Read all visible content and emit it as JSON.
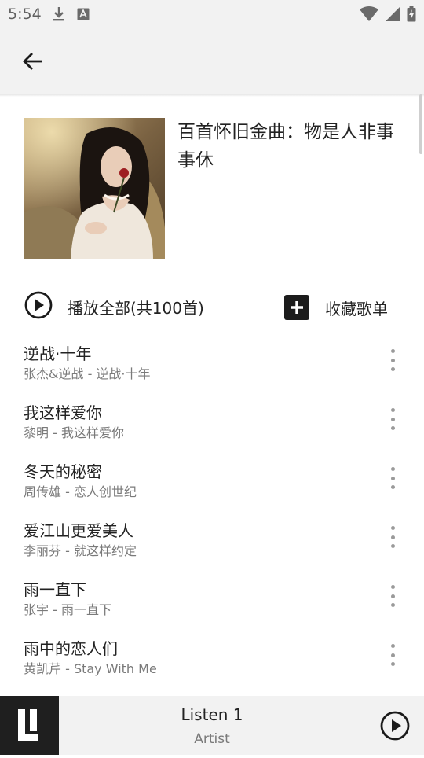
{
  "status_bar": {
    "time": "5:54",
    "icons_left": [
      "download-icon",
      "font-app-icon"
    ],
    "icons_right": [
      "wifi-icon",
      "cell-signal-icon",
      "battery-charging-icon"
    ]
  },
  "app_bar": {
    "back_icon": "arrow-left-icon"
  },
  "playlist": {
    "title": "百首怀旧金曲：物是人非事事休",
    "play_all_label": "播放全部(共100首)",
    "collect_label": "收藏歌单"
  },
  "songs": [
    {
      "title": "逆战·十年",
      "subtitle": "张杰&逆战 - 逆战·十年"
    },
    {
      "title": "我这样爱你",
      "subtitle": "黎明 - 我这样爱你"
    },
    {
      "title": "冬天的秘密",
      "subtitle": "周传雄 - 恋人创世纪"
    },
    {
      "title": "爱江山更爱美人",
      "subtitle": "李丽芬 - 就这样约定"
    },
    {
      "title": "雨一直下",
      "subtitle": "张宇 - 雨一直下"
    },
    {
      "title": "雨中的恋人们",
      "subtitle": "黄凯芹 - Stay With Me"
    }
  ],
  "player": {
    "title": "Listen 1",
    "artist": "Artist"
  },
  "colors": {
    "bar_background": "#f2f2f2",
    "text_primary": "#222222",
    "text_secondary": "#7a7a7a",
    "logo_background": "#1f1f1f"
  }
}
